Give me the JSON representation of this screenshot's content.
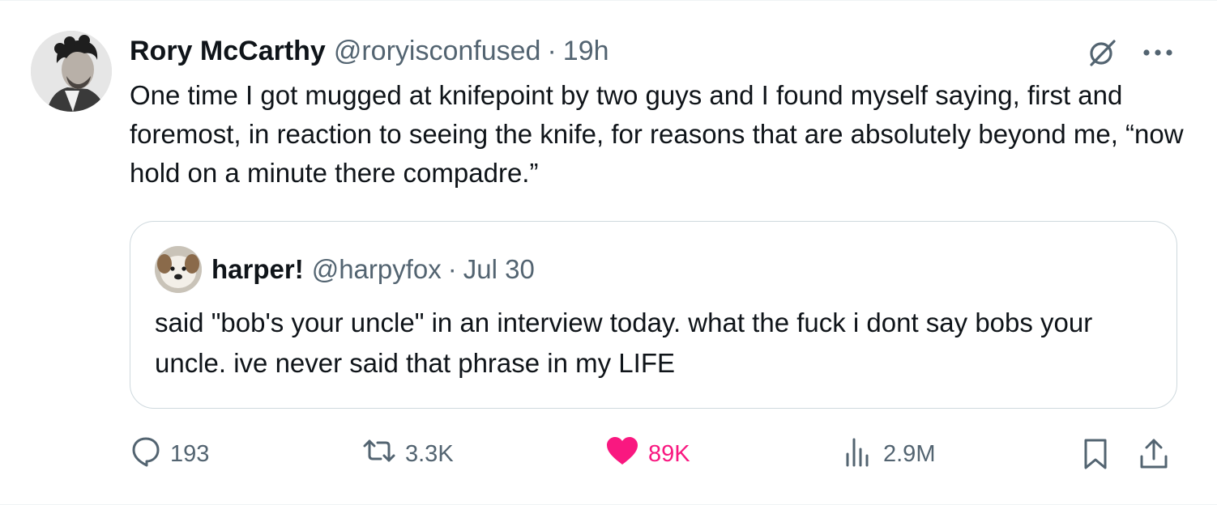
{
  "tweet": {
    "display_name": "Rory McCarthy",
    "handle": "@roryisconfused",
    "separator": "·",
    "time": "19h",
    "text": "One time I got mugged at knifepoint by two guys and I found myself saying, first and foremost, in reaction to seeing the knife, for reasons that are absolutely beyond me, “now hold on a minute there compadre.”"
  },
  "quote": {
    "display_name": "harper!",
    "handle": "@harpyfox",
    "separator": "·",
    "time": "Jul 30",
    "text": "said \"bob's your uncle\" in an interview today. what the fuck i dont say bobs your uncle. ive never said that phrase in my LIFE"
  },
  "actions": {
    "replies": "193",
    "reposts": "3.3K",
    "likes": "89K",
    "views": "2.9M"
  },
  "icons": {
    "reply": "reply-icon",
    "repost": "repost-icon",
    "like": "heart-icon",
    "views": "views-icon",
    "bookmark": "bookmark-icon",
    "share": "share-icon",
    "grok": "grok-icon",
    "more": "more-icon"
  },
  "colors": {
    "text_primary": "#0f1419",
    "text_secondary": "#536471",
    "like_pink": "#f91880",
    "border": "#cfd9de"
  }
}
